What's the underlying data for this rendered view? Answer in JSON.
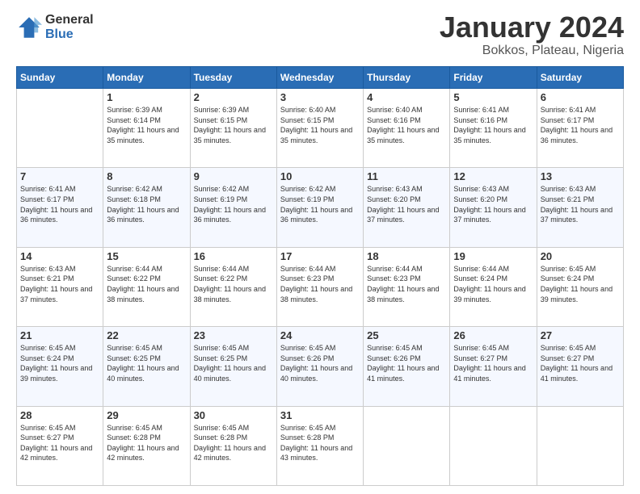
{
  "header": {
    "logo_general": "General",
    "logo_blue": "Blue",
    "title": "January 2024",
    "location": "Bokkos, Plateau, Nigeria"
  },
  "weekdays": [
    "Sunday",
    "Monday",
    "Tuesday",
    "Wednesday",
    "Thursday",
    "Friday",
    "Saturday"
  ],
  "weeks": [
    [
      {
        "day": "",
        "sunrise": "",
        "sunset": "",
        "daylight": ""
      },
      {
        "day": "1",
        "sunrise": "Sunrise: 6:39 AM",
        "sunset": "Sunset: 6:14 PM",
        "daylight": "Daylight: 11 hours and 35 minutes."
      },
      {
        "day": "2",
        "sunrise": "Sunrise: 6:39 AM",
        "sunset": "Sunset: 6:15 PM",
        "daylight": "Daylight: 11 hours and 35 minutes."
      },
      {
        "day": "3",
        "sunrise": "Sunrise: 6:40 AM",
        "sunset": "Sunset: 6:15 PM",
        "daylight": "Daylight: 11 hours and 35 minutes."
      },
      {
        "day": "4",
        "sunrise": "Sunrise: 6:40 AM",
        "sunset": "Sunset: 6:16 PM",
        "daylight": "Daylight: 11 hours and 35 minutes."
      },
      {
        "day": "5",
        "sunrise": "Sunrise: 6:41 AM",
        "sunset": "Sunset: 6:16 PM",
        "daylight": "Daylight: 11 hours and 35 minutes."
      },
      {
        "day": "6",
        "sunrise": "Sunrise: 6:41 AM",
        "sunset": "Sunset: 6:17 PM",
        "daylight": "Daylight: 11 hours and 36 minutes."
      }
    ],
    [
      {
        "day": "7",
        "sunrise": "Sunrise: 6:41 AM",
        "sunset": "Sunset: 6:17 PM",
        "daylight": "Daylight: 11 hours and 36 minutes."
      },
      {
        "day": "8",
        "sunrise": "Sunrise: 6:42 AM",
        "sunset": "Sunset: 6:18 PM",
        "daylight": "Daylight: 11 hours and 36 minutes."
      },
      {
        "day": "9",
        "sunrise": "Sunrise: 6:42 AM",
        "sunset": "Sunset: 6:19 PM",
        "daylight": "Daylight: 11 hours and 36 minutes."
      },
      {
        "day": "10",
        "sunrise": "Sunrise: 6:42 AM",
        "sunset": "Sunset: 6:19 PM",
        "daylight": "Daylight: 11 hours and 36 minutes."
      },
      {
        "day": "11",
        "sunrise": "Sunrise: 6:43 AM",
        "sunset": "Sunset: 6:20 PM",
        "daylight": "Daylight: 11 hours and 37 minutes."
      },
      {
        "day": "12",
        "sunrise": "Sunrise: 6:43 AM",
        "sunset": "Sunset: 6:20 PM",
        "daylight": "Daylight: 11 hours and 37 minutes."
      },
      {
        "day": "13",
        "sunrise": "Sunrise: 6:43 AM",
        "sunset": "Sunset: 6:21 PM",
        "daylight": "Daylight: 11 hours and 37 minutes."
      }
    ],
    [
      {
        "day": "14",
        "sunrise": "Sunrise: 6:43 AM",
        "sunset": "Sunset: 6:21 PM",
        "daylight": "Daylight: 11 hours and 37 minutes."
      },
      {
        "day": "15",
        "sunrise": "Sunrise: 6:44 AM",
        "sunset": "Sunset: 6:22 PM",
        "daylight": "Daylight: 11 hours and 38 minutes."
      },
      {
        "day": "16",
        "sunrise": "Sunrise: 6:44 AM",
        "sunset": "Sunset: 6:22 PM",
        "daylight": "Daylight: 11 hours and 38 minutes."
      },
      {
        "day": "17",
        "sunrise": "Sunrise: 6:44 AM",
        "sunset": "Sunset: 6:23 PM",
        "daylight": "Daylight: 11 hours and 38 minutes."
      },
      {
        "day": "18",
        "sunrise": "Sunrise: 6:44 AM",
        "sunset": "Sunset: 6:23 PM",
        "daylight": "Daylight: 11 hours and 38 minutes."
      },
      {
        "day": "19",
        "sunrise": "Sunrise: 6:44 AM",
        "sunset": "Sunset: 6:24 PM",
        "daylight": "Daylight: 11 hours and 39 minutes."
      },
      {
        "day": "20",
        "sunrise": "Sunrise: 6:45 AM",
        "sunset": "Sunset: 6:24 PM",
        "daylight": "Daylight: 11 hours and 39 minutes."
      }
    ],
    [
      {
        "day": "21",
        "sunrise": "Sunrise: 6:45 AM",
        "sunset": "Sunset: 6:24 PM",
        "daylight": "Daylight: 11 hours and 39 minutes."
      },
      {
        "day": "22",
        "sunrise": "Sunrise: 6:45 AM",
        "sunset": "Sunset: 6:25 PM",
        "daylight": "Daylight: 11 hours and 40 minutes."
      },
      {
        "day": "23",
        "sunrise": "Sunrise: 6:45 AM",
        "sunset": "Sunset: 6:25 PM",
        "daylight": "Daylight: 11 hours and 40 minutes."
      },
      {
        "day": "24",
        "sunrise": "Sunrise: 6:45 AM",
        "sunset": "Sunset: 6:26 PM",
        "daylight": "Daylight: 11 hours and 40 minutes."
      },
      {
        "day": "25",
        "sunrise": "Sunrise: 6:45 AM",
        "sunset": "Sunset: 6:26 PM",
        "daylight": "Daylight: 11 hours and 41 minutes."
      },
      {
        "day": "26",
        "sunrise": "Sunrise: 6:45 AM",
        "sunset": "Sunset: 6:27 PM",
        "daylight": "Daylight: 11 hours and 41 minutes."
      },
      {
        "day": "27",
        "sunrise": "Sunrise: 6:45 AM",
        "sunset": "Sunset: 6:27 PM",
        "daylight": "Daylight: 11 hours and 41 minutes."
      }
    ],
    [
      {
        "day": "28",
        "sunrise": "Sunrise: 6:45 AM",
        "sunset": "Sunset: 6:27 PM",
        "daylight": "Daylight: 11 hours and 42 minutes."
      },
      {
        "day": "29",
        "sunrise": "Sunrise: 6:45 AM",
        "sunset": "Sunset: 6:28 PM",
        "daylight": "Daylight: 11 hours and 42 minutes."
      },
      {
        "day": "30",
        "sunrise": "Sunrise: 6:45 AM",
        "sunset": "Sunset: 6:28 PM",
        "daylight": "Daylight: 11 hours and 42 minutes."
      },
      {
        "day": "31",
        "sunrise": "Sunrise: 6:45 AM",
        "sunset": "Sunset: 6:28 PM",
        "daylight": "Daylight: 11 hours and 43 minutes."
      },
      {
        "day": "",
        "sunrise": "",
        "sunset": "",
        "daylight": ""
      },
      {
        "day": "",
        "sunrise": "",
        "sunset": "",
        "daylight": ""
      },
      {
        "day": "",
        "sunrise": "",
        "sunset": "",
        "daylight": ""
      }
    ]
  ]
}
